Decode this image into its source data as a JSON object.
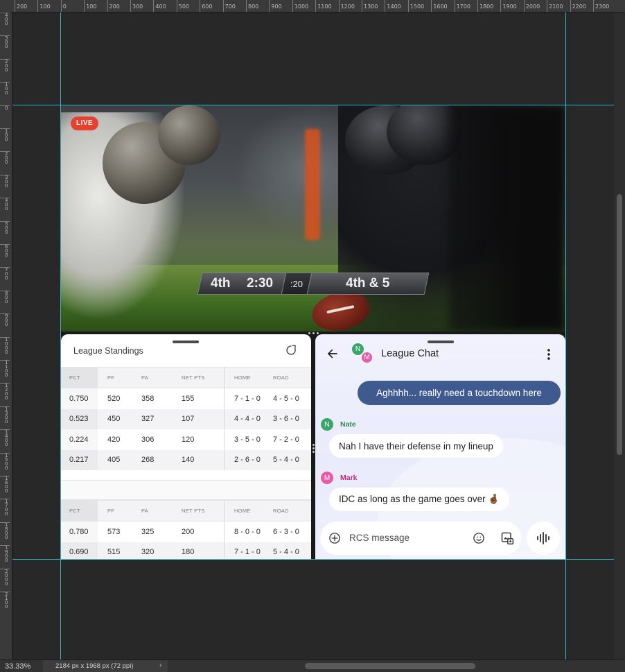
{
  "ruler": {
    "top_labels": [
      "200",
      "100",
      "0",
      "100",
      "200",
      "300",
      "400",
      "500",
      "600",
      "700",
      "800",
      "900",
      "1000",
      "1100",
      "1200",
      "1300",
      "1400",
      "1500",
      "1600",
      "1700",
      "1800",
      "1900",
      "2000",
      "2100",
      "2200",
      "2300"
    ],
    "left_labels": [
      "400",
      "300",
      "200",
      "100",
      "0",
      "100",
      "200",
      "300",
      "400",
      "500",
      "600",
      "700",
      "800",
      "900",
      "1000",
      "1100",
      "1200",
      "1300",
      "1400",
      "1500",
      "1600",
      "1700",
      "1800",
      "1900",
      "2000",
      "2100"
    ]
  },
  "video": {
    "live_label": "LIVE",
    "quarter": "4th",
    "clock": "2:30",
    "play_clock": ":20",
    "down_distance": "4th & 5"
  },
  "standings": {
    "title": "League Standings",
    "columns": [
      "PCT",
      "PF",
      "PA",
      "NET PTS",
      "HOME",
      "ROAD"
    ],
    "table1": [
      [
        "0.750",
        "520",
        "358",
        "155",
        "7 - 1 - 0",
        "4 - 5 - 0"
      ],
      [
        "0.523",
        "450",
        "327",
        "107",
        "4 - 4 - 0",
        "3 - 6 - 0"
      ],
      [
        "0.224",
        "420",
        "306",
        "120",
        "3 - 5 - 0",
        "7 - 2 - 0"
      ],
      [
        "0.217",
        "405",
        "268",
        "140",
        "2 - 6 - 0",
        "5 - 4 - 0"
      ]
    ],
    "table2": [
      [
        "0.780",
        "573",
        "325",
        "200",
        "8 - 0 - 0",
        "6 - 3 - 0"
      ],
      [
        "0.690",
        "515",
        "320",
        "180",
        "7 - 1 - 0",
        "5 - 4 - 0"
      ]
    ]
  },
  "chat": {
    "title": "League Chat",
    "avatar_n": "N",
    "avatar_m": "M",
    "outgoing": "Aghhhh... really need a touchdown here",
    "messages": [
      {
        "sender": "Nate",
        "initial": "N",
        "text": "Nah I have their defense in my lineup"
      },
      {
        "sender": "Mark",
        "initial": "M",
        "text": "IDC as long as the game goes over 🤞🏾"
      }
    ],
    "compose_placeholder": "RCS message"
  },
  "statusbar": {
    "zoom": "33.33%",
    "doc_info": "2184 px x 1968 px (72 ppi)",
    "caret": "›"
  },
  "colors": {
    "guide": "#2fd0d8",
    "live": "#e8402e",
    "outgoing_bubble": "#3f5a8e",
    "nate": "#3aa66a",
    "mark": "#e85aa5"
  }
}
